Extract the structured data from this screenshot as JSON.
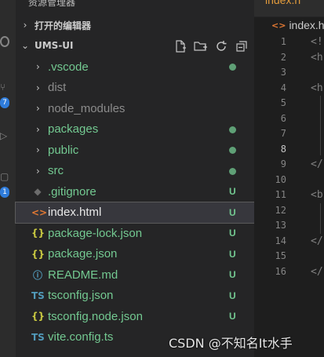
{
  "sidebar": {
    "explorer_title": "资源管理器",
    "open_editors_label": "打开的编辑器",
    "project_label": "UMS-UI",
    "actions": [
      {
        "name": "new-file-icon",
        "glyph": "🗋"
      },
      {
        "name": "new-folder-icon",
        "glyph": "🗀"
      },
      {
        "name": "refresh-icon",
        "glyph": "↻"
      },
      {
        "name": "collapse-all-icon",
        "glyph": "⧉"
      }
    ],
    "items": [
      {
        "label": ".vscode",
        "type": "folder",
        "color": "green",
        "marker": "dot"
      },
      {
        "label": "dist",
        "type": "folder",
        "color": "dim",
        "marker": ""
      },
      {
        "label": "node_modules",
        "type": "folder",
        "color": "dim",
        "marker": ""
      },
      {
        "label": "packages",
        "type": "folder",
        "color": "green",
        "marker": "dot"
      },
      {
        "label": "public",
        "type": "folder",
        "color": "green",
        "marker": "dot"
      },
      {
        "label": "src",
        "type": "folder",
        "color": "green",
        "marker": "dot"
      },
      {
        "label": ".gitignore",
        "type": "file",
        "icon": "git-icon",
        "glyph": "◆",
        "icon_color": "#6c6c6c",
        "color": "green",
        "marker": "U"
      },
      {
        "label": "index.html",
        "type": "file",
        "icon": "html-icon",
        "glyph": "<>",
        "icon_color": "#e37933",
        "color": "white",
        "marker": "U",
        "active": true
      },
      {
        "label": "package-lock.json",
        "type": "file",
        "icon": "json-icon",
        "glyph": "{}",
        "icon_color": "#cbcb41",
        "color": "green",
        "marker": "U"
      },
      {
        "label": "package.json",
        "type": "file",
        "icon": "json-icon",
        "glyph": "{}",
        "icon_color": "#cbcb41",
        "color": "green",
        "marker": "U"
      },
      {
        "label": "README.md",
        "type": "file",
        "icon": "info-icon",
        "glyph": "ⓘ",
        "icon_color": "#519aba",
        "color": "green",
        "marker": "U"
      },
      {
        "label": "tsconfig.json",
        "type": "file",
        "icon": "ts-config-icon",
        "glyph": "TS",
        "icon_color": "#519aba",
        "color": "green",
        "marker": "U"
      },
      {
        "label": "tsconfig.node.json",
        "type": "file",
        "icon": "json-icon",
        "glyph": "{}",
        "icon_color": "#cbcb41",
        "color": "green",
        "marker": "U"
      },
      {
        "label": "vite.config.ts",
        "type": "file",
        "icon": "ts-icon",
        "glyph": "TS",
        "icon_color": "#519aba",
        "color": "green",
        "marker": ""
      }
    ]
  },
  "editor": {
    "tab_label": "index.h",
    "breadcrumb": "index.h",
    "line_numbers": [
      "1",
      "2",
      "3",
      "4",
      "5",
      "6",
      "7",
      "8",
      "9",
      "10",
      "11",
      "12",
      "13",
      "14",
      "15",
      "16"
    ],
    "current_line": "8",
    "code_lines": [
      "<!",
      "<h",
      "",
      "<h",
      "",
      "",
      "",
      "",
      "</",
      "",
      "<b",
      "",
      "",
      "</",
      "",
      "</"
    ]
  },
  "watermark": "CSDN @不知名It水手",
  "colors": {
    "accent": "#2f7cdb",
    "git_untracked": "#73c991",
    "html": "#e37933",
    "json": "#cbcb41",
    "ts": "#519aba"
  }
}
